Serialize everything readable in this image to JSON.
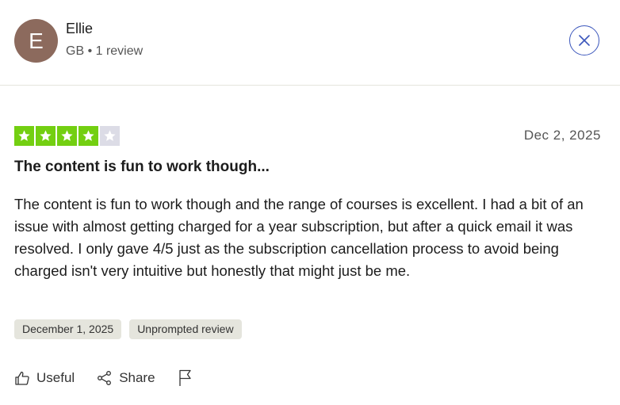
{
  "reviewer": {
    "initial": "E",
    "name": "Ellie",
    "meta": "GB • 1 review"
  },
  "review": {
    "rating": 4,
    "max_rating": 5,
    "date": "Dec 2, 2025",
    "title": "The content is fun to work though...",
    "body": "The content is fun to work though and the range of courses is excellent. I had a bit of an issue with almost getting charged for a year subscription, but after a quick email it was resolved. I only gave 4/5 just as the subscription cancellation process to avoid being charged isn't very intuitive but honestly that might just be me.",
    "tags": [
      "December 1, 2025",
      "Unprompted review"
    ]
  },
  "actions": {
    "useful_label": "Useful",
    "share_label": "Share"
  },
  "icons": {
    "close": "close-icon",
    "star": "star-icon",
    "useful": "thumbs-up-icon",
    "share": "share-icon",
    "flag": "flag-icon"
  },
  "colors": {
    "star_on": "#73cf11",
    "star_off": "#dcdce6",
    "avatar_bg": "#8c6a5d",
    "close_border": "#3c57bc"
  }
}
